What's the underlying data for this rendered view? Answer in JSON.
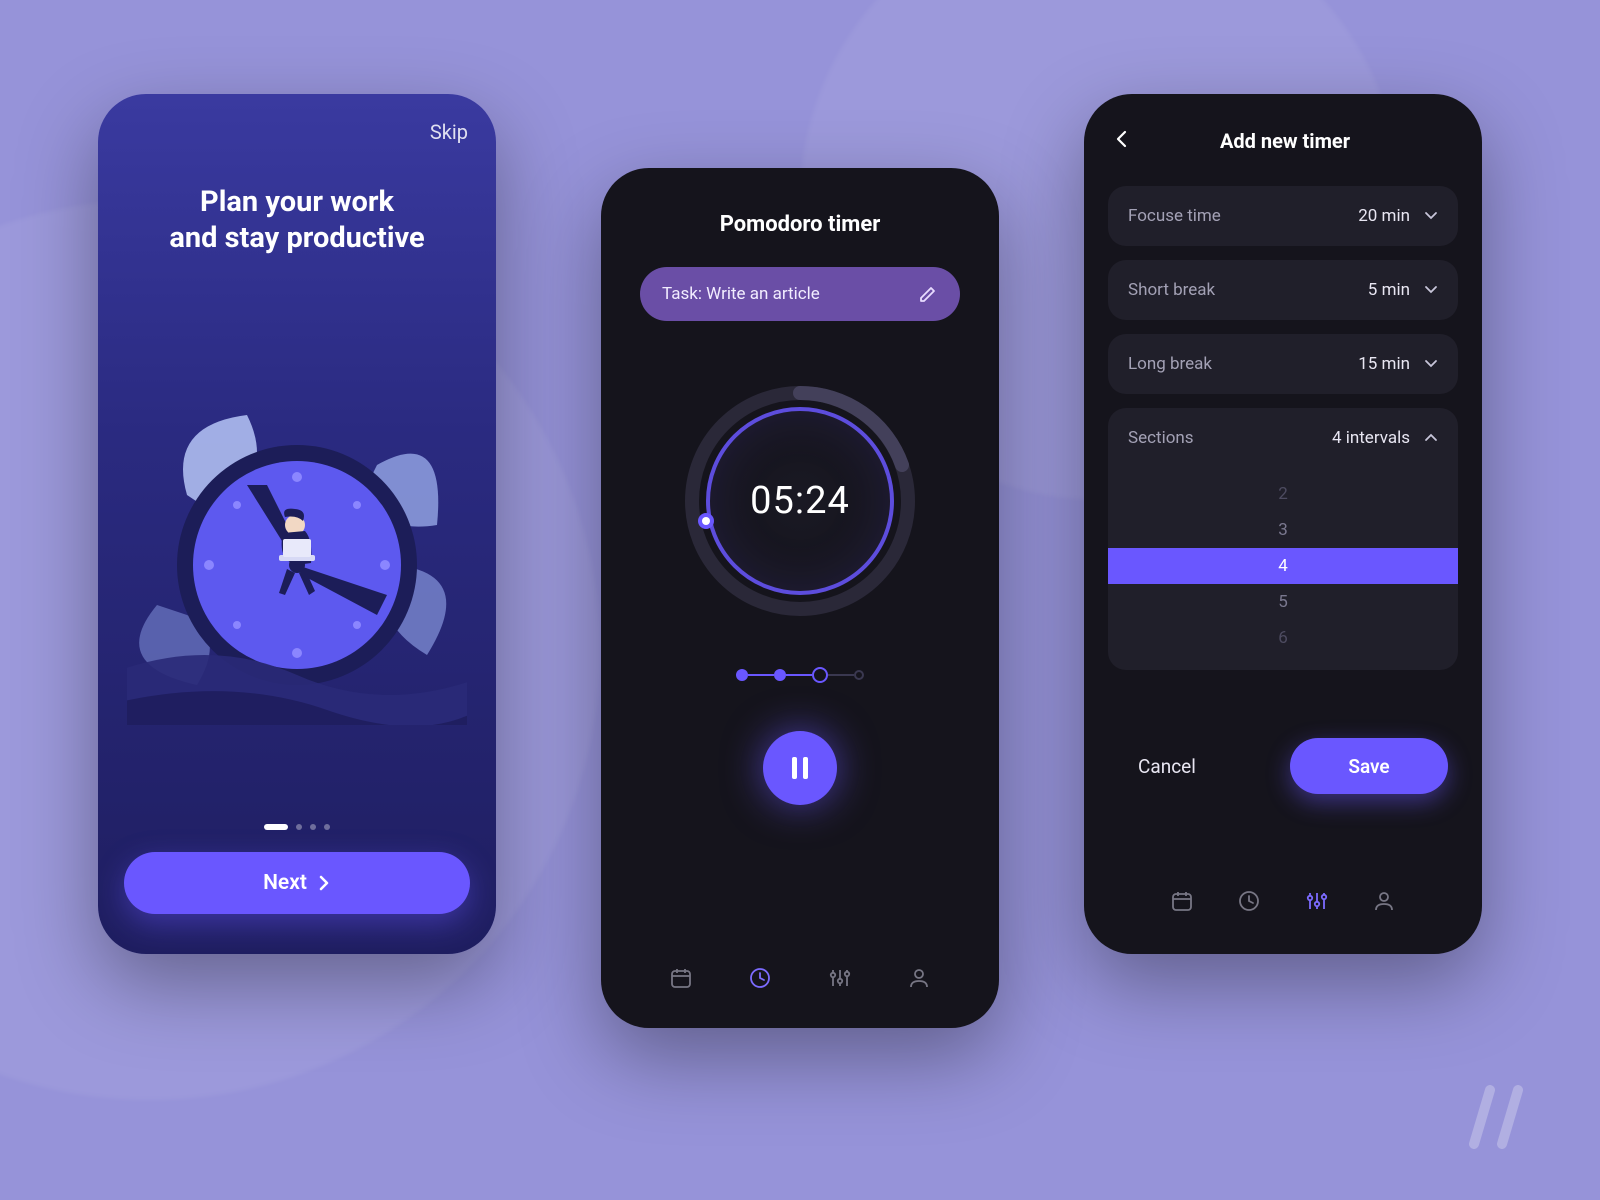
{
  "colors": {
    "accent": "#6a57ff",
    "bg_dark": "#15141c",
    "panel": "#201f2a"
  },
  "onboarding": {
    "skip": "Skip",
    "title_line1": "Plan your work",
    "title_line2": "and stay productive",
    "next": "Next"
  },
  "timer": {
    "title": "Pomodoro timer",
    "task_label": "Task: Write an article",
    "time": "05:24"
  },
  "add_timer": {
    "title": "Add new timer",
    "rows": [
      {
        "label": "Focuse time",
        "value": "20 min"
      },
      {
        "label": "Short break",
        "value": "5 min"
      },
      {
        "label": "Long break",
        "value": "15 min"
      }
    ],
    "sections_label": "Sections",
    "sections_value": "4 intervals",
    "wheel": [
      "2",
      "3",
      "4",
      "5",
      "6"
    ],
    "cancel": "Cancel",
    "save": "Save"
  }
}
